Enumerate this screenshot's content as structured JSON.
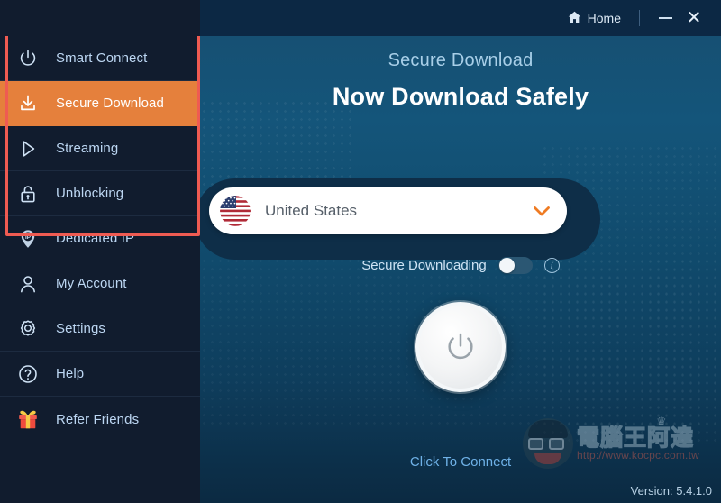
{
  "titlebar": {
    "home_label": "Home",
    "home_icon": "home-icon",
    "minimize_icon": "minimize-icon",
    "close_icon": "close-icon",
    "close_glyph": "✕"
  },
  "sidebar": {
    "items": [
      {
        "label": "Smart Connect",
        "icon": "power-icon",
        "active": false
      },
      {
        "label": "Secure Download",
        "icon": "download-icon",
        "active": true
      },
      {
        "label": "Streaming",
        "icon": "play-icon",
        "active": false
      },
      {
        "label": "Unblocking",
        "icon": "lock-icon",
        "active": false
      },
      {
        "label": "Dedicated IP",
        "icon": "ip-pin-icon",
        "active": false
      },
      {
        "label": "My Account",
        "icon": "user-icon",
        "active": false
      },
      {
        "label": "Settings",
        "icon": "gear-icon",
        "active": false
      },
      {
        "label": "Help",
        "icon": "question-icon",
        "active": false
      },
      {
        "label": "Refer Friends",
        "icon": "gift-icon",
        "active": false
      }
    ]
  },
  "main": {
    "subtitle": "Secure Download",
    "title": "Now Download Safely",
    "country": {
      "name": "United States",
      "flag_icon": "us-flag-icon",
      "chevron_icon": "chevron-down-icon",
      "chevron_glyph": "⌄"
    },
    "toggle": {
      "label": "Secure Downloading",
      "state": "off",
      "info_icon": "info-icon",
      "info_glyph": "i"
    },
    "power_button": {
      "icon": "power-icon",
      "state": "disconnected"
    },
    "connect_text": "Click To Connect"
  },
  "footer": {
    "version": "Version: 5.4.1.0"
  },
  "watermark": {
    "site_name": "電腦王阿達",
    "url": "http://www.kocpc.com.tw",
    "crown_glyph": "♛",
    "face_icon": "mascot-face-icon"
  },
  "annotation": {
    "type": "red-rectangle-highlight",
    "color": "#ef5b52"
  },
  "colors": {
    "accent_orange": "#e5803c",
    "sidebar_bg": "#111c2e",
    "titlebar_bg": "#0c2844",
    "main_bg": "#14557a",
    "link_blue": "#6fb2e8",
    "annotation_red": "#ef5b52"
  }
}
